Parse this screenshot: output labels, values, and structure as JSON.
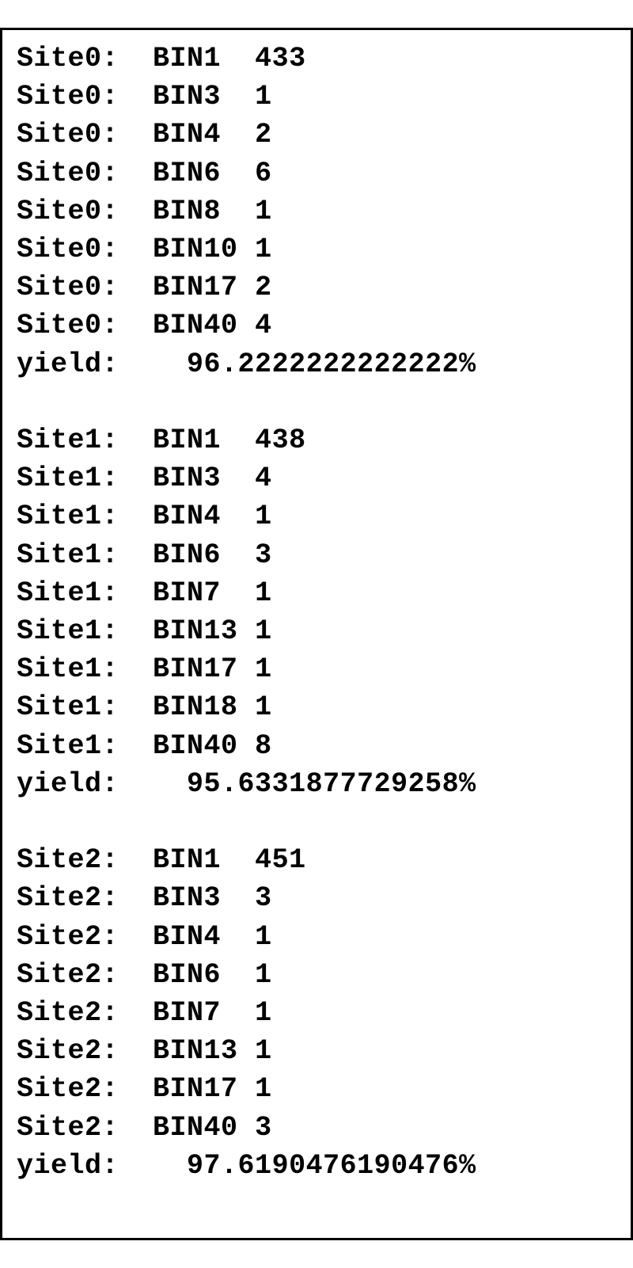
{
  "sites": [
    {
      "label": "Site0:",
      "bins": [
        {
          "name": "BIN1",
          "count": "433"
        },
        {
          "name": "BIN3",
          "count": "1"
        },
        {
          "name": "BIN4",
          "count": "2"
        },
        {
          "name": "BIN6",
          "count": "6"
        },
        {
          "name": "BIN8",
          "count": "1"
        },
        {
          "name": "BIN10",
          "count": "1"
        },
        {
          "name": "BIN17",
          "count": "2"
        },
        {
          "name": "BIN40",
          "count": "4"
        }
      ],
      "yield_label": "yield:",
      "yield_value": "96.2222222222222%"
    },
    {
      "label": "Site1:",
      "bins": [
        {
          "name": "BIN1",
          "count": "438"
        },
        {
          "name": "BIN3",
          "count": "4"
        },
        {
          "name": "BIN4",
          "count": "1"
        },
        {
          "name": "BIN6",
          "count": "3"
        },
        {
          "name": "BIN7",
          "count": "1"
        },
        {
          "name": "BIN13",
          "count": "1"
        },
        {
          "name": "BIN17",
          "count": "1"
        },
        {
          "name": "BIN18",
          "count": "1"
        },
        {
          "name": "BIN40",
          "count": "8"
        }
      ],
      "yield_label": "yield:",
      "yield_value": "95.6331877729258%"
    },
    {
      "label": "Site2:",
      "bins": [
        {
          "name": "BIN1",
          "count": "451"
        },
        {
          "name": "BIN3",
          "count": "3"
        },
        {
          "name": "BIN4",
          "count": "1"
        },
        {
          "name": "BIN6",
          "count": "1"
        },
        {
          "name": "BIN7",
          "count": "1"
        },
        {
          "name": "BIN13",
          "count": "1"
        },
        {
          "name": "BIN17",
          "count": "1"
        },
        {
          "name": "BIN40",
          "count": "3"
        }
      ],
      "yield_label": "yield:",
      "yield_value": "97.6190476190476%"
    }
  ]
}
